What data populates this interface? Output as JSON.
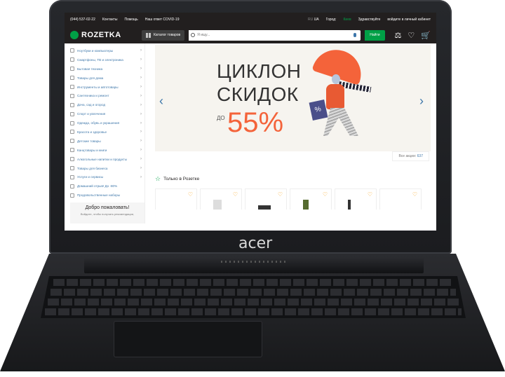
{
  "device": {
    "brand_logo": "acer"
  },
  "site": {
    "topbar": {
      "phone": "(044) 537-02-22",
      "links": [
        "Контакты",
        "Помощь",
        "Наш ответ COVID-19"
      ],
      "lang_ru": "RU",
      "lang_ua": "UA",
      "city_label": "Город:",
      "city": "Киев",
      "greeting": "Здравствуйте",
      "login": "войдите в личный кабинет"
    },
    "header": {
      "logo": "ROZETKA",
      "catalog_button": "Каталог товаров",
      "search_placeholder": "Я ищу...",
      "search_button": "Найти"
    },
    "categories": [
      "Ноутбуки и компьютеры",
      "Смартфоны, ТВ и электроника",
      "Бытовая техника",
      "Товары для дома",
      "Инструменты и автотовары",
      "Сантехника и ремонт",
      "Дача, сад и огород",
      "Спорт и увлечения",
      "Одежда, обувь и украшения",
      "Красота и здоровье",
      "Детские товары",
      "Канцтовары и книги",
      "Алкогольные напитки и продукты",
      "Товары для бизнеса",
      "Услуги и сервисы",
      "Домашний отрыв! До -80%",
      "Продовольственные наборы"
    ],
    "welcome": {
      "title": "Добро пожаловать!",
      "subtitle": "Войдите, чтобы получать рекомендации,"
    },
    "banner": {
      "line1": "ЦИКЛОН",
      "line2": "СКИДОК",
      "prefix": "ДО",
      "percent": "55%"
    },
    "all_promos_label": "Все акции:",
    "all_promos_count": "637",
    "section_title": "Только в Розетке"
  },
  "colors": {
    "accent_green": "#00a046",
    "promo_orange": "#f4633a",
    "link_blue": "#3e77aa",
    "topbar_dark": "#221f1f"
  }
}
